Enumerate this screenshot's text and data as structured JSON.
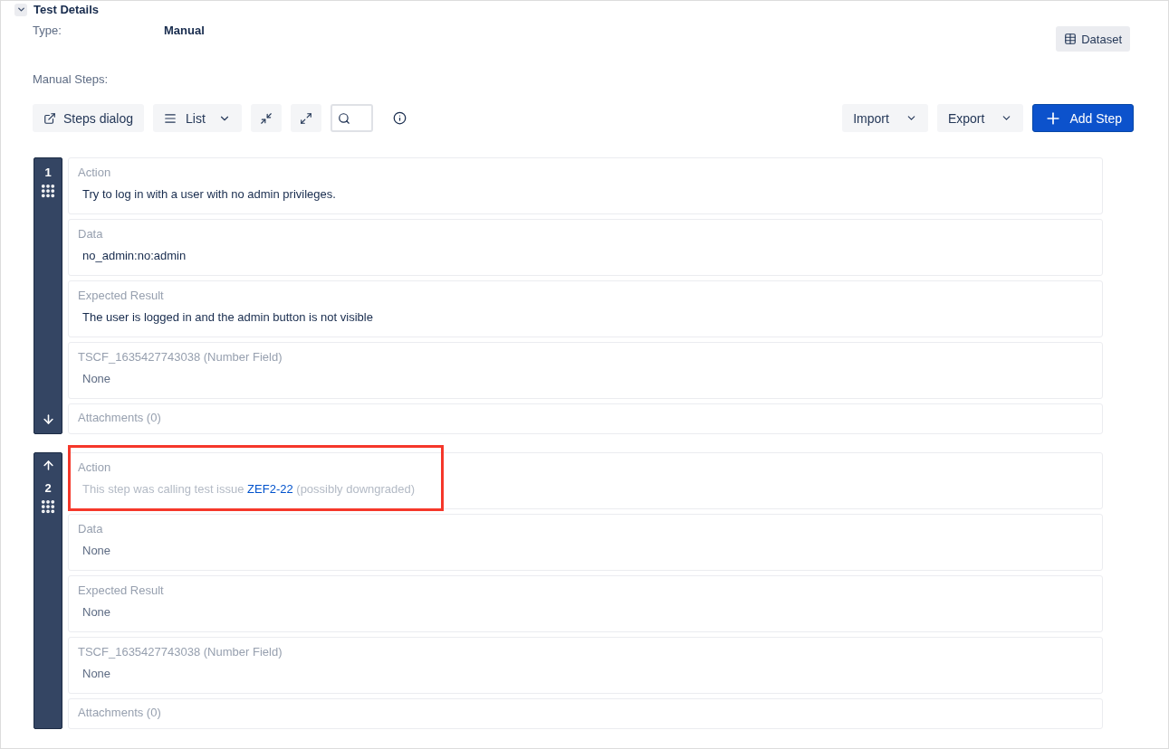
{
  "section": {
    "title": "Test Details",
    "expanded": true
  },
  "type": {
    "label": "Type:",
    "value": "Manual"
  },
  "dataset_button": "Dataset",
  "steps_label": "Manual Steps:",
  "toolbar": {
    "steps_dialog": "Steps dialog",
    "view": "List",
    "import": "Import",
    "export": "Export",
    "add_step": "Add Step"
  },
  "steps": [
    {
      "number": "1",
      "move_up": false,
      "move_down": true,
      "fields": [
        {
          "label": "Action",
          "kind": "text",
          "value": "Try to log in with a user with no admin privileges.",
          "highlighted": false
        },
        {
          "label": "Data",
          "kind": "text",
          "value": "no_admin:no:admin",
          "highlighted": false
        },
        {
          "label": "Expected Result",
          "kind": "text",
          "value": "The user is logged in and the admin button is not visible",
          "highlighted": false
        },
        {
          "label": "TSCF_1635427743038 (Number Field)",
          "kind": "empty",
          "value": "None",
          "highlighted": false
        },
        {
          "label": "Attachments (0)",
          "kind": "attachments",
          "highlighted": false
        }
      ]
    },
    {
      "number": "2",
      "move_up": true,
      "move_down": false,
      "fields": [
        {
          "label": "Action",
          "kind": "call",
          "before": "This step was calling test issue",
          "link": "ZEF2-22",
          "after": "(possibly downgraded)",
          "highlighted": true
        },
        {
          "label": "Data",
          "kind": "empty",
          "value": "None",
          "highlighted": false
        },
        {
          "label": "Expected Result",
          "kind": "empty",
          "value": "None",
          "highlighted": false
        },
        {
          "label": "TSCF_1635427743038 (Number Field)",
          "kind": "empty",
          "value": "None",
          "highlighted": false
        },
        {
          "label": "Attachments (0)",
          "kind": "attachments",
          "highlighted": false
        }
      ]
    }
  ]
}
